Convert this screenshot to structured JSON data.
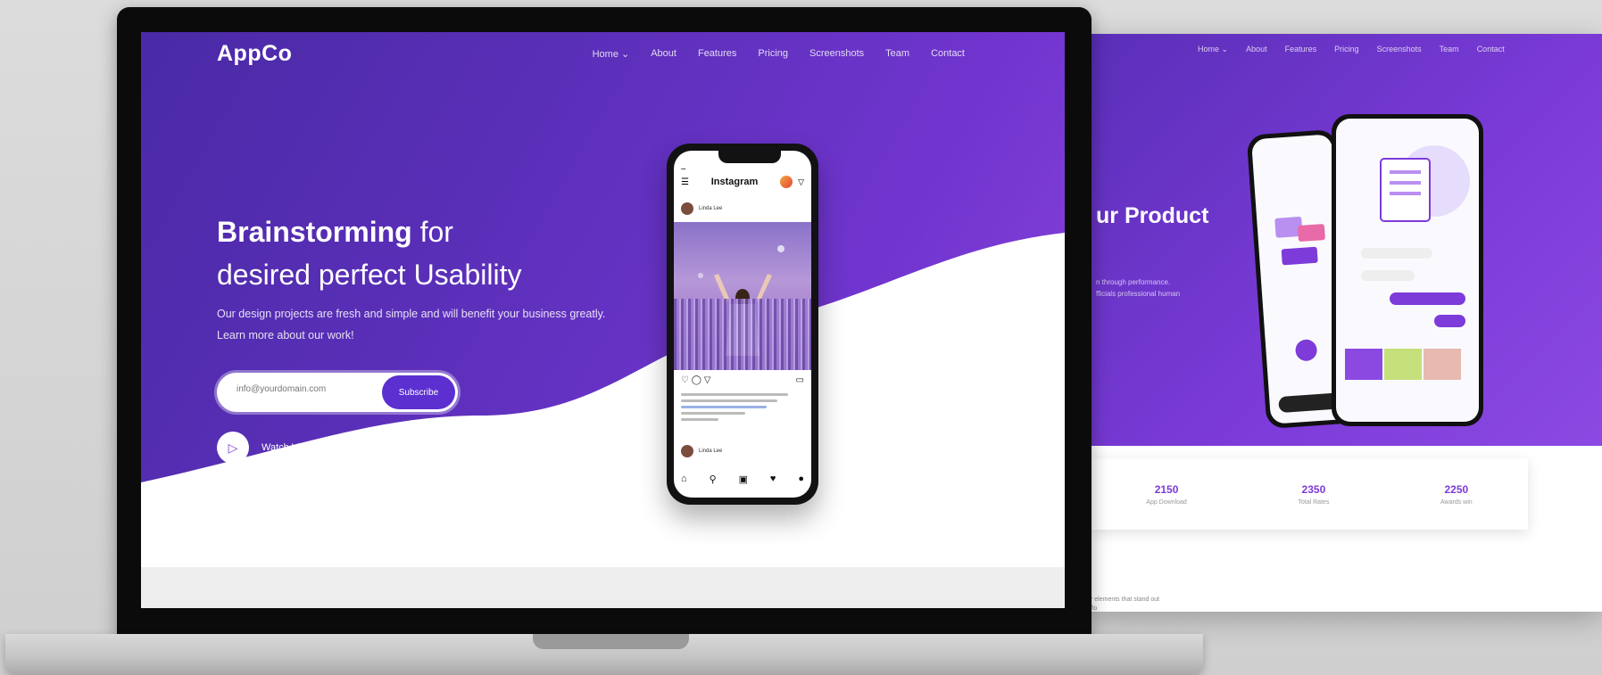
{
  "brand": {
    "logo": "AppCo"
  },
  "nav": {
    "items": [
      "Home ⌄",
      "About",
      "Features",
      "Pricing",
      "Screenshots",
      "Team",
      "Contact"
    ]
  },
  "hero": {
    "headline_bold": "Brainstorming",
    "headline_rest": " for",
    "headline_line2": "desired perfect Usability",
    "description": "Our design projects are fresh and simple and will benefit your business greatly. Learn more about our work!",
    "email_placeholder": "info@yourdomain.com",
    "subscribe_label": "Subscribe",
    "watch_label": "Watch Video Overview"
  },
  "phone": {
    "brand": "Instagram",
    "username": "Linda Lee",
    "comment_user": "Linda Lee"
  },
  "second_screen": {
    "nav": [
      "Home ⌄",
      "About",
      "Features",
      "Pricing",
      "Screenshots",
      "Team",
      "Contact"
    ],
    "title": "ur Product",
    "subtitle": "n through performance.\nfficials professional human",
    "stats": [
      {
        "value": "2150",
        "label": "App Download"
      },
      {
        "value": "2350",
        "label": "Total Rates"
      },
      {
        "value": "2250",
        "label": "Awards win"
      }
    ],
    "footer_text": "r elements that stand out\nflo"
  },
  "colors": {
    "primary": "#5a2fb8",
    "accent": "#8d44dd",
    "button": "#5c2fd0"
  }
}
